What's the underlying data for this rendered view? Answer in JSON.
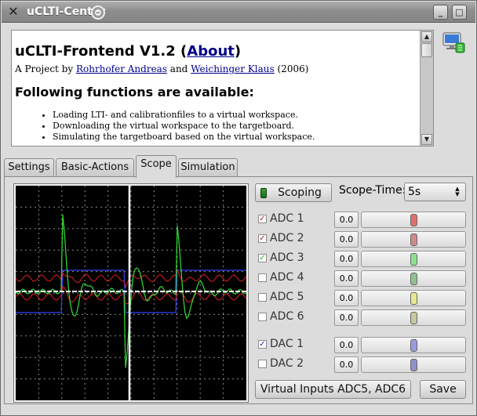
{
  "window": {
    "title": "uCLTI-Center"
  },
  "info": {
    "heading_prefix": "uCLTI-Frontend V1.2 (",
    "about_link": "About",
    "heading_suffix": ")",
    "byline_prefix": "A Project by ",
    "author1": "Rohrhofer Andreas",
    "byline_and": " and ",
    "author2": "Weichinger Klaus",
    "byline_year": " (2006)",
    "functions_heading": "Following functions are available:",
    "functions": [
      "Loading LTI- and calibrationfiles to a virtual workspace.",
      "Downloading the virtual workspace to the targetboard.",
      "Simulating the targetboard based on the virtual workspace."
    ]
  },
  "tabs": [
    {
      "label": "Settings"
    },
    {
      "label": "Basic-Actions"
    },
    {
      "label": "Scope"
    },
    {
      "label": "Simulation"
    }
  ],
  "active_tab": "Scope",
  "scope": {
    "scoping_label": "Scoping",
    "time_label": "Scope-Time:",
    "time_value": "5s",
    "virtual_inputs_label": "Virtual Inputs ADC5, ADC6",
    "save_label": "Save"
  },
  "channels": [
    {
      "label": "ADC 1",
      "checked": true,
      "check_color": "#c02020",
      "value": "0.0",
      "knob_color": "#e07070"
    },
    {
      "label": "ADC 2",
      "checked": true,
      "check_color": "#a02020",
      "value": "0.0",
      "knob_color": "#d08a8a"
    },
    {
      "label": "ADC 3",
      "checked": true,
      "check_color": "#20b020",
      "value": "0.0",
      "knob_color": "#8ee08e"
    },
    {
      "label": "ADC 4",
      "checked": false,
      "check_color": "#208020",
      "value": "0.0",
      "knob_color": "#90c090"
    },
    {
      "label": "ADC 5",
      "checked": false,
      "check_color": "#e0e000",
      "value": "0.0",
      "knob_color": "#e8e890"
    },
    {
      "label": "ADC 6",
      "checked": false,
      "check_color": "#808040",
      "value": "0.0",
      "knob_color": "#c8c8a0"
    },
    {
      "label": "DAC 1",
      "checked": true,
      "check_color": "#2020a0",
      "value": "0.0",
      "knob_color": "#9a9ae0"
    },
    {
      "label": "DAC 2",
      "checked": false,
      "check_color": "#202080",
      "value": "0.0",
      "knob_color": "#9090c8"
    }
  ],
  "colors": {
    "trace_green": "#33dd33",
    "trace_red": "#dd2020",
    "trace_blue": "#3344ff",
    "trace_white": "#ffffff",
    "grid": "#8a8a8a"
  }
}
